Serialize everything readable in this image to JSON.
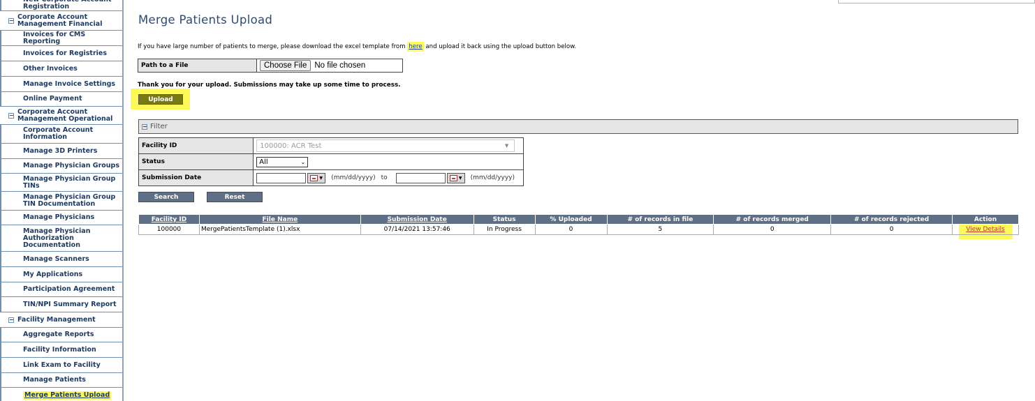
{
  "sidebar": {
    "items": [
      {
        "type": "item",
        "label": "New Corporate Account Registration"
      },
      {
        "type": "group",
        "label": "Corporate Account Management Financial",
        "toggle": "−"
      },
      {
        "type": "item",
        "label": "Invoices for CMS Reporting"
      },
      {
        "type": "item",
        "label": "Invoices for Registries"
      },
      {
        "type": "item",
        "label": "Other Invoices"
      },
      {
        "type": "item",
        "label": "Manage Invoice Settings"
      },
      {
        "type": "item",
        "label": "Online Payment"
      },
      {
        "type": "group",
        "label": "Corporate Account Management Operational",
        "toggle": "−"
      },
      {
        "type": "item",
        "label": "Corporate Account Information"
      },
      {
        "type": "item",
        "label": "Manage 3D Printers"
      },
      {
        "type": "item",
        "label": "Manage Physician Groups"
      },
      {
        "type": "item",
        "label": "Manage Physician Group TINs"
      },
      {
        "type": "item",
        "label": "Manage Physician Group TIN Documentation"
      },
      {
        "type": "item",
        "label": "Manage Physicians"
      },
      {
        "type": "item",
        "label": "Manage Physician Authorization Documentation"
      },
      {
        "type": "item",
        "label": "Manage Scanners"
      },
      {
        "type": "item",
        "label": "My Applications"
      },
      {
        "type": "item",
        "label": "Participation Agreement"
      },
      {
        "type": "item",
        "label": "TIN/NPI Summary Report"
      },
      {
        "type": "group",
        "label": "Facility Management",
        "toggle": "−"
      },
      {
        "type": "item",
        "label": "Aggregate Reports"
      },
      {
        "type": "item",
        "label": "Facility Information"
      },
      {
        "type": "item",
        "label": "Link Exam to Facility"
      },
      {
        "type": "item",
        "label": "Manage Patients"
      },
      {
        "type": "item",
        "label": "Merge Patients Upload",
        "active": true
      }
    ]
  },
  "page": {
    "title": "Merge Patients Upload",
    "instructions_before": "If you have large number of patients to merge, please download the excel template from ",
    "instructions_link": "here",
    "instructions_after": " and upload it back using the upload button below.",
    "path_label": "Path to a File",
    "choose_file": "Choose File",
    "no_file": "No file chosen",
    "thanks": "Thank you for your upload. Submissions may take up some time to process.",
    "upload": "Upload"
  },
  "filter": {
    "title": "Filter",
    "toggle": "−",
    "facility_label": "Facility ID",
    "facility_value": "100000: ACR Test",
    "status_label": "Status",
    "status_value": "All",
    "date_label": "Submission Date",
    "date_hint": "(mm/dd/yyyy)",
    "to": "to",
    "search": "Search",
    "reset": "Reset"
  },
  "results": {
    "headers": [
      "Facility ID",
      "File Name",
      "Submission Date",
      "Status",
      "% Uploaded",
      "# of records in file",
      "# of records merged",
      "# of records rejected",
      "Action"
    ],
    "rows": [
      {
        "facility_id": "100000",
        "file_name": "MergePatientsTemplate (1).xlsx",
        "submission_date": "07/14/2021 13:57:46",
        "status": "In Progress",
        "uploaded": "0",
        "records_in_file": "5",
        "records_merged": "0",
        "records_rejected": "0",
        "action": "View Details"
      }
    ]
  },
  "colors": {
    "highlight": "#fdfa58",
    "header_bg": "#5f6f86",
    "upload_bg": "#7a7a12",
    "nav_text": "#1f3b63"
  }
}
